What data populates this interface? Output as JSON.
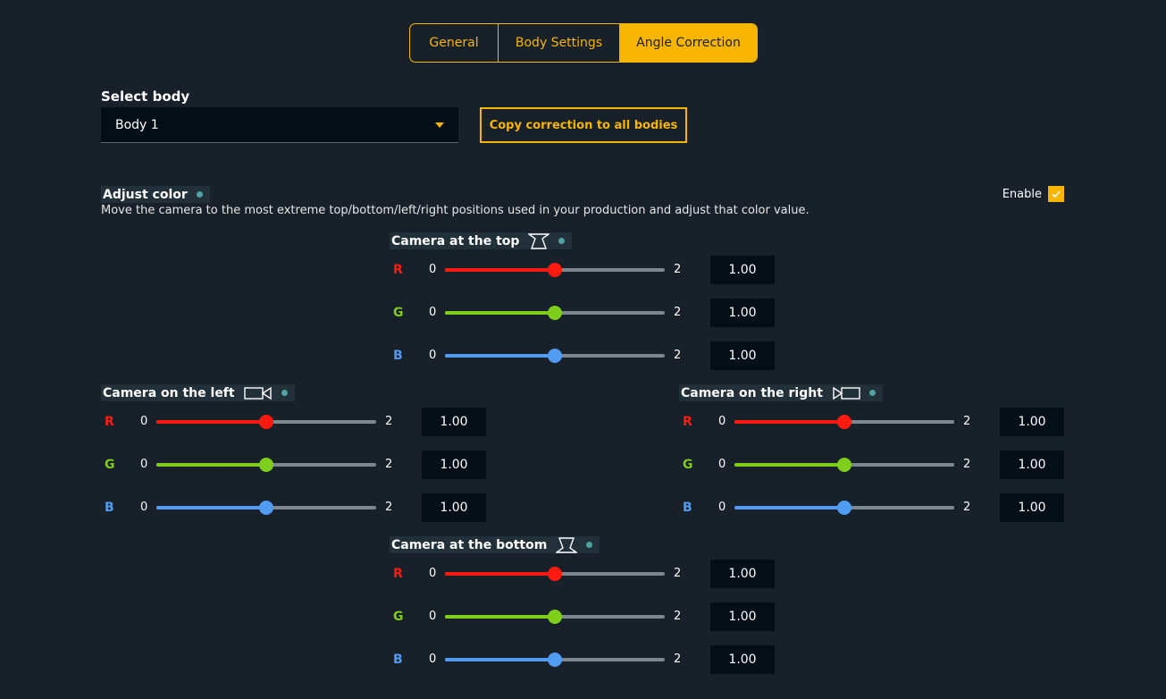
{
  "tabs": [
    {
      "label": "General",
      "active": false
    },
    {
      "label": "Body Settings",
      "active": false
    },
    {
      "label": "Angle Correction",
      "active": true
    }
  ],
  "select_body": {
    "label": "Select body",
    "value": "Body 1",
    "copy_button": "Copy correction to all bodies"
  },
  "adjust_color": {
    "title": "Adjust color",
    "description": "Move the camera to the most extreme top/bottom/left/right positions used in your production and adjust that color value.",
    "enable_label": "Enable",
    "enabled": true
  },
  "colors": {
    "accent": "#f7b500",
    "r": "#ff1a10",
    "g": "#7fce1c",
    "b": "#4f9cf2"
  },
  "cameras": {
    "top": {
      "title": "Camera at the top",
      "icon": "camera-top-icon",
      "channels": [
        {
          "name": "R",
          "min": "0",
          "max": "2",
          "value": "1.00",
          "fraction": 0.5
        },
        {
          "name": "G",
          "min": "0",
          "max": "2",
          "value": "1.00",
          "fraction": 0.5
        },
        {
          "name": "B",
          "min": "0",
          "max": "2",
          "value": "1.00",
          "fraction": 0.5
        }
      ]
    },
    "left": {
      "title": "Camera on the left",
      "icon": "camera-left-icon",
      "channels": [
        {
          "name": "R",
          "min": "0",
          "max": "2",
          "value": "1.00",
          "fraction": 0.5
        },
        {
          "name": "G",
          "min": "0",
          "max": "2",
          "value": "1.00",
          "fraction": 0.5
        },
        {
          "name": "B",
          "min": "0",
          "max": "2",
          "value": "1.00",
          "fraction": 0.5
        }
      ]
    },
    "right": {
      "title": "Camera on the right",
      "icon": "camera-right-icon",
      "channels": [
        {
          "name": "R",
          "min": "0",
          "max": "2",
          "value": "1.00",
          "fraction": 0.5
        },
        {
          "name": "G",
          "min": "0",
          "max": "2",
          "value": "1.00",
          "fraction": 0.5
        },
        {
          "name": "B",
          "min": "0",
          "max": "2",
          "value": "1.00",
          "fraction": 0.5
        }
      ]
    },
    "bottom": {
      "title": "Camera at the bottom",
      "icon": "camera-bottom-icon",
      "channels": [
        {
          "name": "R",
          "min": "0",
          "max": "2",
          "value": "1.00",
          "fraction": 0.5
        },
        {
          "name": "G",
          "min": "0",
          "max": "2",
          "value": "1.00",
          "fraction": 0.5
        },
        {
          "name": "B",
          "min": "0",
          "max": "2",
          "value": "1.00",
          "fraction": 0.5
        }
      ]
    }
  }
}
